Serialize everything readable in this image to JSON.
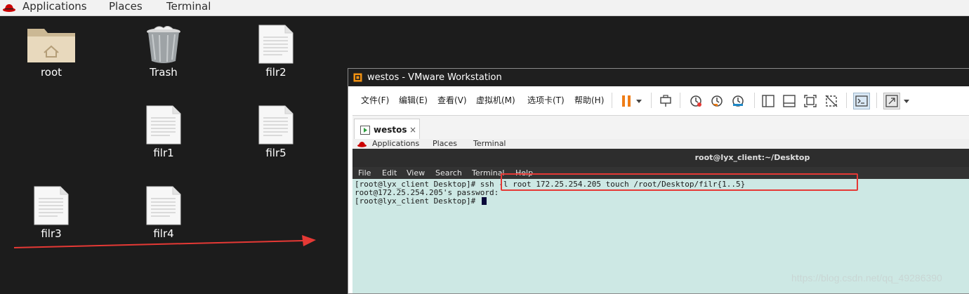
{
  "topbar": {
    "applications": "Applications",
    "places": "Places",
    "terminal": "Terminal"
  },
  "desktop": {
    "icons": [
      {
        "label": "root"
      },
      {
        "label": "Trash"
      },
      {
        "label": "filr2"
      },
      {
        "label": "filr1"
      },
      {
        "label": "filr5"
      },
      {
        "label": "filr3"
      },
      {
        "label": "filr4"
      }
    ]
  },
  "vmware": {
    "title": "westos - VMware Workstation",
    "menu": [
      "文件(F)",
      "编辑(E)",
      "查看(V)",
      "虚拟机(M)",
      "选项卡(T)",
      "帮助(H)"
    ],
    "tab": {
      "label": "westos",
      "close": "×"
    },
    "guest": {
      "topbar": {
        "applications": "Applications",
        "places": "Places",
        "terminal": "Terminal"
      },
      "terminal_title": "root@lyx_client:~/Desktop",
      "terminal_menu": [
        "File",
        "Edit",
        "View",
        "Search",
        "Terminal",
        "Help"
      ],
      "lines": [
        "[root@lyx_client Desktop]# ssh -l root 172.25.254.205 touch /root/Desktop/filr{1..5}",
        "root@172.25.254.205's password:",
        "[root@lyx_client Desktop]# "
      ]
    }
  },
  "watermark": "https://blog.csdn.net/qq_49286390",
  "colors": {
    "annotation": "#e53935",
    "terminal_bg": "#cde8e4"
  }
}
